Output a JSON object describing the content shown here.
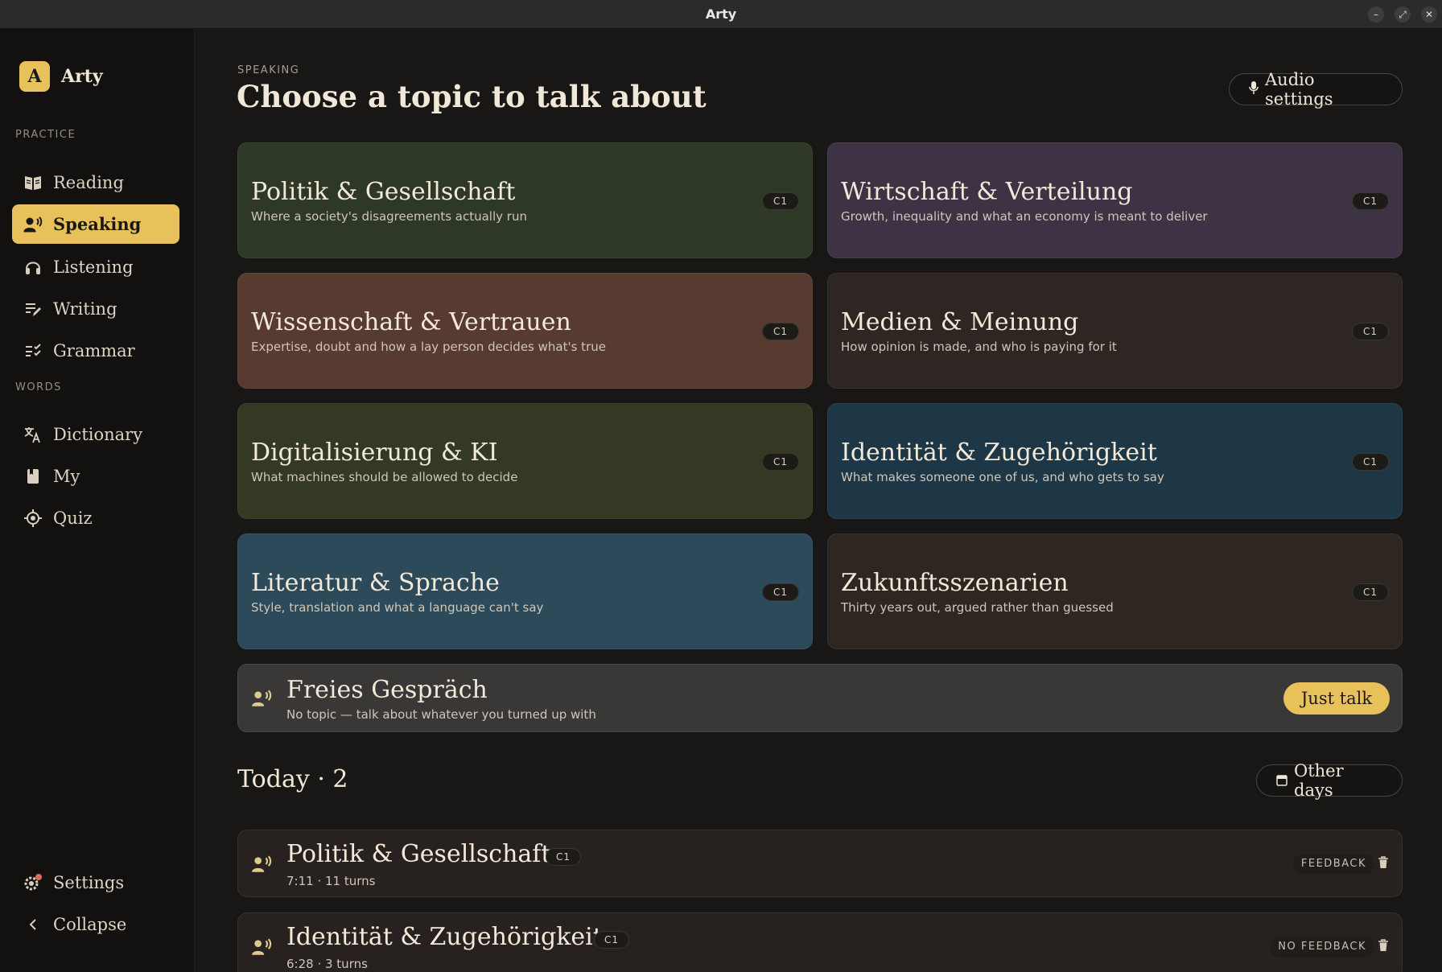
{
  "window": {
    "title": "Arty"
  },
  "brand": {
    "logo_letter": "A",
    "name": "Arty"
  },
  "sidebar": {
    "practice_label": "PRACTICE",
    "words_label": "WORDS",
    "items": [
      {
        "label": "Reading",
        "icon": "book-open-icon"
      },
      {
        "label": "Speaking",
        "icon": "speaking-person-icon",
        "active": true
      },
      {
        "label": "Listening",
        "icon": "headphones-icon"
      },
      {
        "label": "Writing",
        "icon": "pencil-lines-icon"
      },
      {
        "label": "Grammar",
        "icon": "checklist-icon"
      },
      {
        "label": "Dictionary",
        "icon": "translate-icon"
      },
      {
        "label": "My",
        "icon": "bookmark-book-icon"
      },
      {
        "label": "Quiz",
        "icon": "target-icon"
      }
    ],
    "settings_label": "Settings",
    "collapse_label": "Collapse"
  },
  "header": {
    "eyebrow": "SPEAKING",
    "title": "Choose a topic to talk about",
    "audio_settings_label": "Audio settings"
  },
  "topics": [
    {
      "name": "Politik & Gesellschaft",
      "desc": "Where a society's disagreements actually run",
      "level": "C1",
      "color": "#2d3826"
    },
    {
      "name": "Wirtschaft & Verteilung",
      "desc": "Growth, inequality and what an economy is meant to deliver",
      "level": "C1",
      "color": "#3d3345"
    },
    {
      "name": "Wissenschaft & Vertrauen",
      "desc": "Expertise, doubt and how a lay person decides what's true",
      "level": "C1",
      "color": "#573a30"
    },
    {
      "name": "Medien & Meinung",
      "desc": "How opinion is made, and who is paying for it",
      "level": "C1",
      "color": "#2d2622"
    },
    {
      "name": "Digitalisierung & KI",
      "desc": "What machines should be allowed to decide",
      "level": "C1",
      "color": "#333923"
    },
    {
      "name": "Identität & Zugehörigkeit",
      "desc": "What makes someone one of us, and who gets to say",
      "level": "C1",
      "color": "#1e3747"
    },
    {
      "name": "Literatur & Sprache",
      "desc": "Style, translation and what a language can't say",
      "level": "C1",
      "color": "#2d4a5a"
    },
    {
      "name": "Zukunftsszenarien",
      "desc": "Thirty years out, argued rather than guessed",
      "level": "C1",
      "color": "#2e2621"
    }
  ],
  "free_talk": {
    "name": "Freies Gespräch",
    "desc": "No topic — talk about whatever you turned up with",
    "button_label": "Just talk"
  },
  "today": {
    "title": "Today · 2",
    "other_days_label": "Other days",
    "sessions": [
      {
        "name": "Politik & Gesellschaft",
        "level": "C1",
        "meta": "7:11 · 11 turns",
        "feedback": "FEEDBACK"
      },
      {
        "name": "Identität & Zugehörigkeit",
        "level": "C1",
        "meta": "6:28 · 3 turns",
        "feedback": "NO FEEDBACK"
      }
    ]
  }
}
